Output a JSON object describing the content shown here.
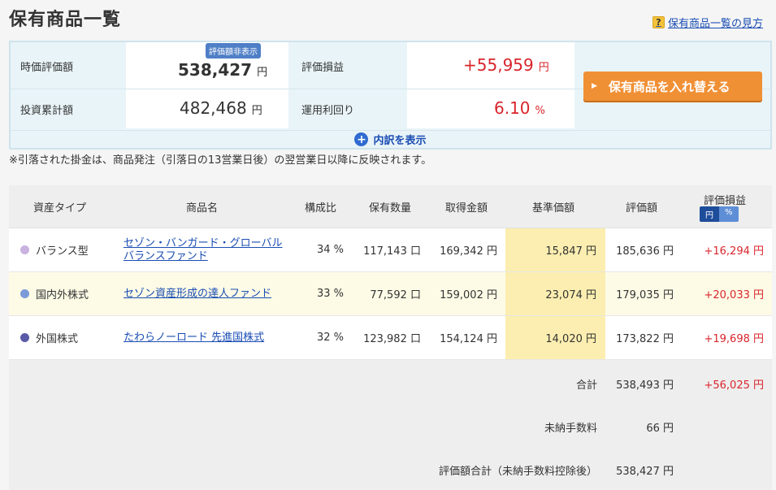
{
  "page": {
    "title": "保有商品一覧",
    "help_link": "保有商品一覧の見方",
    "help_icon": "?"
  },
  "summary": {
    "market_value_label": "時価評価額",
    "market_value": "538,427",
    "hide_badge": "評価額非表示",
    "invested_label": "投資累計額",
    "invested": "482,468",
    "gain_label": "評価損益",
    "gain": "+55,959",
    "yield_label": "運用利回り",
    "yield": "6.10",
    "yield_unit": "%",
    "yen": "円",
    "replace_button": "保有商品を入れ替える",
    "detail_toggle": "内訳を表示"
  },
  "note": "※引落された掛金は、商品発注（引落日の13営業日後）の翌営業日以降に反映されます。",
  "table": {
    "headers": {
      "asset_type": "資産タイプ",
      "product": "商品名",
      "ratio": "構成比",
      "holdings": "保有数量",
      "cost": "取得金額",
      "base_price": "基準価額",
      "valuation": "評価額",
      "gain": "評価損益",
      "toggle_yen": "円",
      "toggle_pct": "%"
    },
    "rows": [
      {
        "asset_type": "バランス型",
        "dot_color": "#c9b2e0",
        "product_line1": "セゾン・バンガード・グローバル",
        "product_line2": "バランスファンド",
        "ratio": "34 %",
        "holdings": "117,143 口",
        "cost": "169,342 円",
        "base_price": "15,847 円",
        "valuation": "185,636 円",
        "gain": "+16,294 円"
      },
      {
        "asset_type": "国内外株式",
        "dot_color": "#7c9ad8",
        "product_line1": "セゾン資産形成の達人ファンド",
        "product_line2": "",
        "ratio": "33 %",
        "holdings": "77,592 口",
        "cost": "159,002 円",
        "base_price": "23,074 円",
        "valuation": "179,035 円",
        "gain": "+20,033 円"
      },
      {
        "asset_type": "外国株式",
        "dot_color": "#5a5aa8",
        "product_line1": "たわらノーロード 先進国株式",
        "product_line2": "",
        "ratio": "32 %",
        "holdings": "123,982 口",
        "cost": "154,124 円",
        "base_price": "14,020 円",
        "valuation": "173,822 円",
        "gain": "+19,698 円"
      }
    ],
    "footer": {
      "total_label": "合計",
      "total_value": "538,493 円",
      "total_gain": "+56,025 円",
      "unpaid_fee_label": "未納手数料",
      "unpaid_fee_value": "66 円",
      "net_label": "評価額合計（未納手数料控除後）",
      "net_value": "538,427 円"
    }
  },
  "colors": {
    "accent_orange": "#f09035",
    "link_blue": "#1a4db3",
    "gain_red": "#d9252c",
    "highlight_yellow": "#fbeeb0"
  }
}
